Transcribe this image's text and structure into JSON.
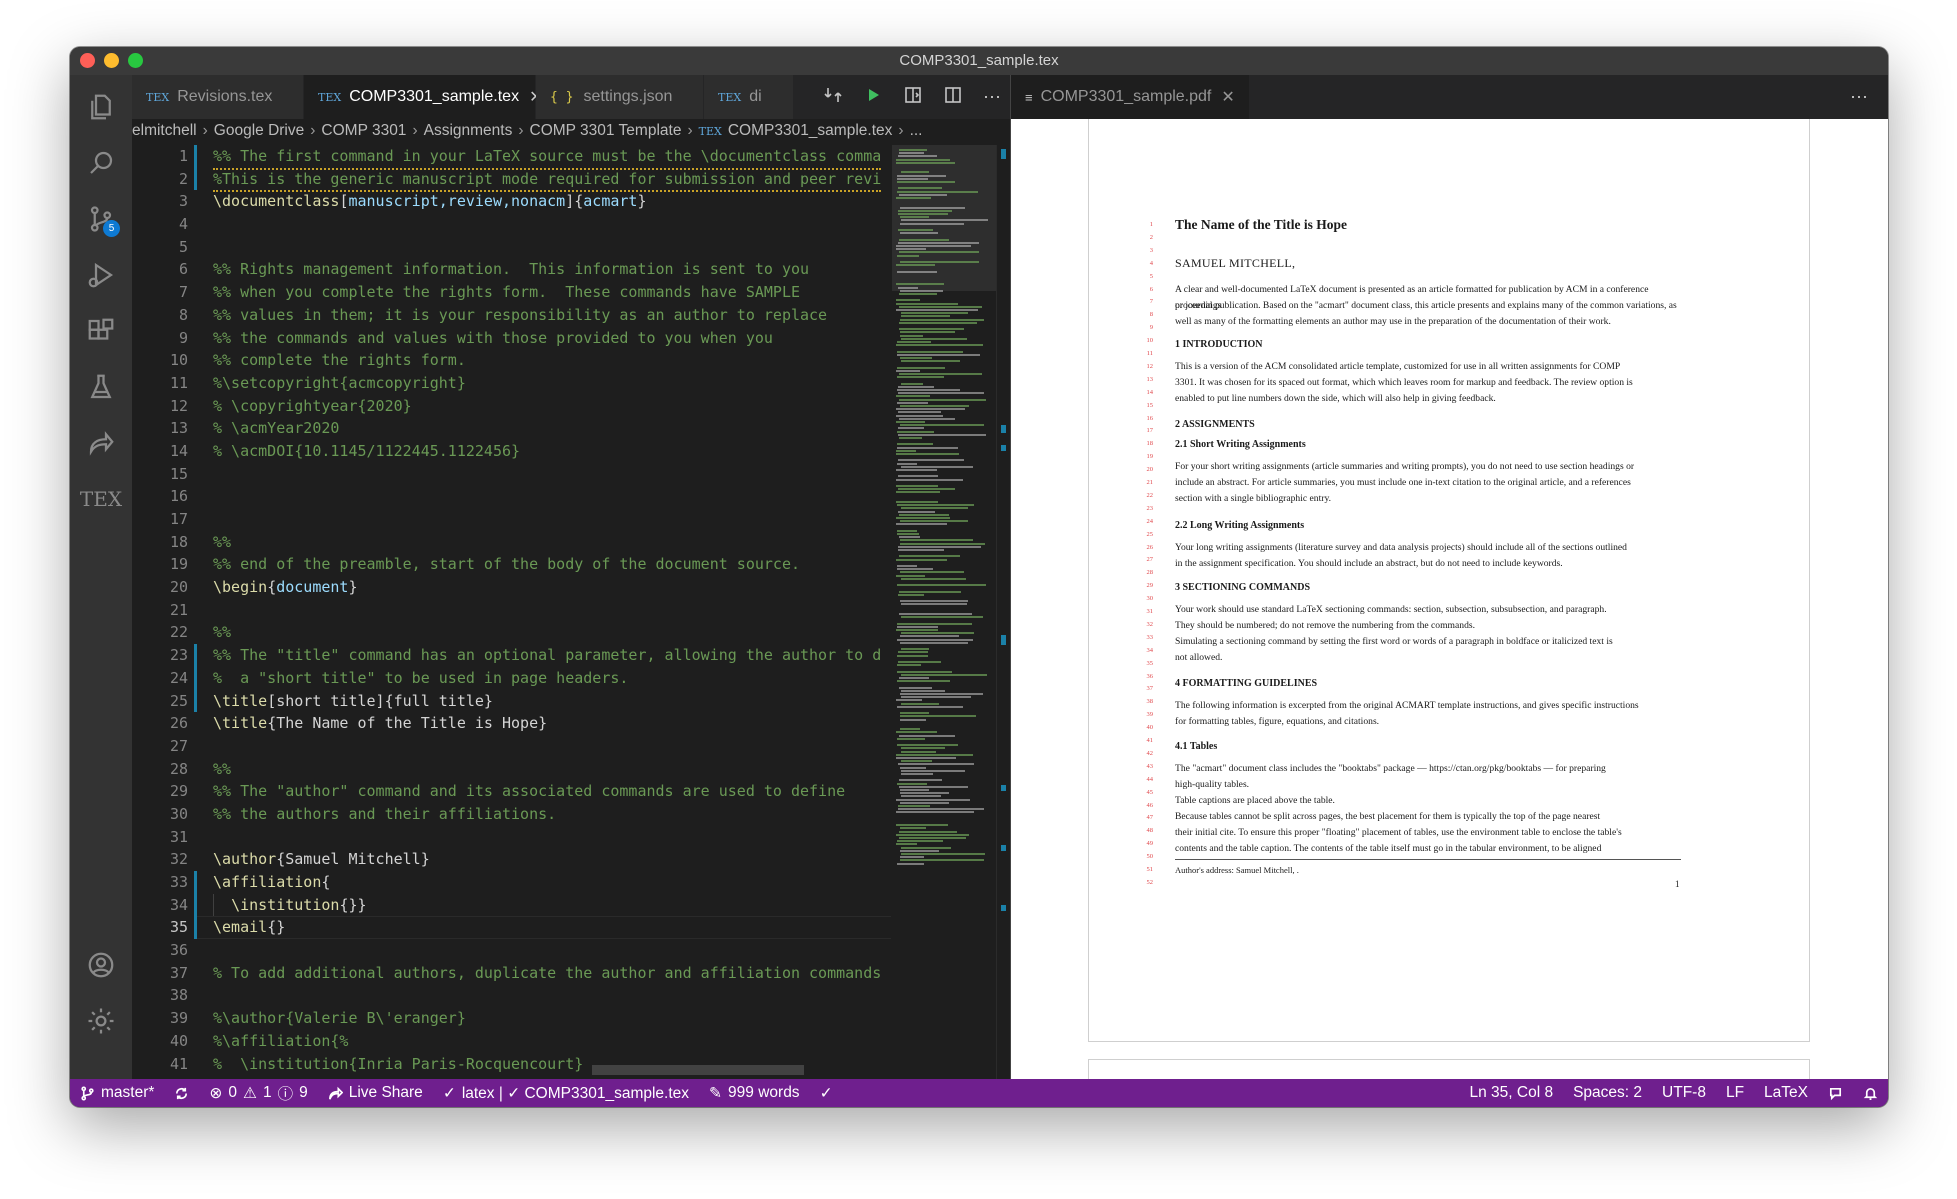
{
  "window": {
    "title": "COMP3301_sample.tex"
  },
  "activity_bar": {
    "scm_badge": "5",
    "tex_label": "TEX"
  },
  "left_tabs": [
    {
      "label": "Revisions.tex"
    },
    {
      "label": "COMP3301_sample.tex"
    },
    {
      "label": "settings.json"
    },
    {
      "label": "di"
    }
  ],
  "breadcrumb": [
    "elmitchell",
    "Google Drive",
    "COMP 3301",
    "Assignments",
    "COMP 3301 Template",
    "COMP3301_sample.tex",
    "..."
  ],
  "code_lines": [
    "%% The first command in your LaTeX source must be the \\documentclass comma",
    "%This is the generic manuscript mode required for submission and peer revi",
    "\\documentclass[manuscript,review,nonacm]{acmart}",
    "",
    "",
    "%% Rights management information.  This information is sent to you",
    "%% when you complete the rights form.  These commands have SAMPLE",
    "%% values in them; it is your responsibility as an author to replace",
    "%% the commands and values with those provided to you when you",
    "%% complete the rights form.",
    "%\\setcopyright{acmcopyright}",
    "% \\copyrightyear{2020}",
    "% \\acmYear2020",
    "% \\acmDOI{10.1145/1122445.1122456}",
    "",
    "",
    "",
    "%%",
    "%% end of the preamble, start of the body of the document source.",
    "\\begin{document}",
    "",
    "%%",
    "%% The \"title\" command has an optional parameter, allowing the author to d",
    "%  a \"short title\" to be used in page headers.",
    "\\title[short title]{full title}",
    "\\title{The Name of the Title is Hope}",
    "",
    "%%",
    "%% The \"author\" command and its associated commands are used to define",
    "%% the authors and their affiliations.",
    "",
    "\\author{Samuel Mitchell}",
    "\\affiliation{",
    "  \\institution{}}",
    "\\email{}",
    "",
    "% To add additional authors, duplicate the author and affiliation commands",
    "",
    "%\\author{Valerie B\\'eranger}",
    "%\\affiliation{%",
    "%  \\institution{Inria Paris-Rocquencourt}"
  ],
  "right_tab": {
    "label": "COMP3301_sample.pdf"
  },
  "pdf": {
    "title": "The Name of the Title is Hope",
    "author": "SAMUEL MITCHELL,",
    "abstract": [
      "A clear and well-documented LaTeX document is presented as an article formatted for publication by ACM in a conference proceedings",
      "or journal publication. Based on the \"acmart\" document class, this article presents and explains many of the common variations, as",
      "well as many of the formatting elements an author may use in the preparation of the documentation of their work."
    ],
    "s1": "1    INTRODUCTION",
    "s1_text": [
      "This is a version of the ACM consolidated article template, customized for use in all written assignments for COMP",
      "3301. It was chosen for its spaced out format, which which leaves room for markup and feedback. The review option is",
      "enabled to put line numbers down the side, which will also help in giving feedback."
    ],
    "s2": "2    ASSIGNMENTS",
    "s21": "2.1    Short Writing Assignments",
    "s21_text": [
      "For your short writing assignments (article summaries and writing prompts), you do not need to use section headings or",
      "include an abstract. For article summaries, you must include one in-text citation to the original article, and a references",
      "section with a single bibliographic entry."
    ],
    "s22": "2.2    Long Writing Assignments",
    "s22_text": [
      "Your long writing assignments (literature survey and data analysis projects) should include all of the sections outlined",
      "in the assignment specification. You should include an abstract, but do not need to include keywords."
    ],
    "s3": "3    SECTIONING COMMANDS",
    "s3_text": [
      "Your work should use standard LaTeX sectioning commands: section, subsection, subsubsection, and paragraph.",
      "They should be numbered; do not remove the numbering from the commands.",
      "    Simulating a sectioning command by setting the first word or words of a paragraph in boldface or italicized text is",
      "not allowed."
    ],
    "s4": "4    FORMATTING GUIDELINES",
    "s4_text": [
      "The following information is excerpted from the original ACMART template instructions, and gives specific instructions",
      "for formatting tables, figure, equations, and citations."
    ],
    "s41": "4.1    Tables",
    "s41_text": [
      "The \"acmart\" document class includes the \"booktabs\" package — https://ctan.org/pkg/booktabs — for preparing",
      "high-quality tables.",
      "    Table captions are placed above the table.",
      "    Because tables cannot be split across pages, the best placement for them is typically the top of the page nearest",
      "their initial cite. To ensure this proper \"floating\" placement of tables, use the environment table to enclose the table's",
      "contents and the table caption. The contents of the table itself must go in the tabular environment, to be aligned"
    ],
    "footnote": "Author's address: Samuel Mitchell, .",
    "page_number": "1"
  },
  "status": {
    "branch": "master*",
    "errors": "0",
    "warnings": "1",
    "info": "9",
    "live_share": "Live Share",
    "build": "latex | ✓ COMP3301_sample.tex",
    "words": "999 words",
    "position": "Ln 35, Col 8",
    "spaces": "Spaces: 2",
    "encoding": "UTF-8",
    "eol": "LF",
    "language": "LaTeX"
  }
}
